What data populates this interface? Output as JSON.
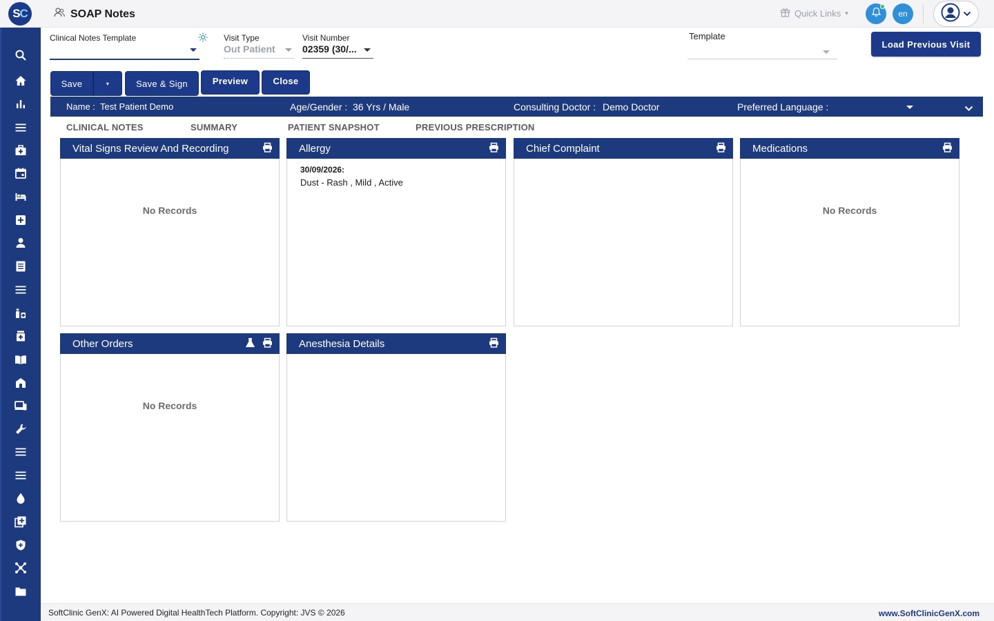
{
  "header": {
    "logo_text_s": "S",
    "logo_text_c": "C",
    "page_title": "SOAP Notes",
    "quick_links": "Quick Links",
    "lang": "en"
  },
  "form": {
    "clinical_notes_template_label": "Clinical Notes Template",
    "clinical_notes_template_value": "",
    "visit_type_label": "Visit Type",
    "visit_type_value": "Out Patient",
    "visit_number_label": "Visit Number",
    "visit_number_value": "02359 (30/...",
    "template_label": "Template",
    "template_value": ""
  },
  "actions": {
    "save": "Save",
    "save_sign": "Save & Sign",
    "preview": "Preview",
    "close": "Close",
    "load_previous_visit": "Load Previous Visit"
  },
  "patient": {
    "name_label": "Name :",
    "name_value": "Test Patient Demo",
    "age_gender_label": "Age/Gender :",
    "age_gender_value": "36 Yrs / Male",
    "doctor_label": "Consulting Doctor :",
    "doctor_value": "Demo Doctor",
    "language_label": "Preferred Language :",
    "language_value": ""
  },
  "tabs": [
    {
      "label": "CLINICAL NOTES"
    },
    {
      "label": "SUMMARY"
    },
    {
      "label": "PATIENT SNAPSHOT"
    },
    {
      "label": "PREVIOUS PRESCRIPTION"
    }
  ],
  "cards": {
    "vitals": {
      "title": "Vital Signs Review And Recording",
      "empty": "No Records"
    },
    "allergy": {
      "title": "Allergy",
      "date": "30/09/2026:",
      "text": "Dust - Rash , Mild , Active"
    },
    "chief_complaint": {
      "title": "Chief Complaint"
    },
    "medications": {
      "title": "Medications",
      "empty": "No Records"
    },
    "other_orders": {
      "title": "Other Orders",
      "empty": "No Records"
    },
    "anesthesia": {
      "title": "Anesthesia Details"
    }
  },
  "footer": {
    "copyright": "SoftClinic GenX: AI Powered Digital HealthTech Platform. Copyright: JVS © 2026",
    "website": "www.SoftClinicGenX.com"
  },
  "colors": {
    "primary": "#1d3a7e",
    "accent": "#2f8fd8",
    "notification_dot": "#35c35a"
  }
}
